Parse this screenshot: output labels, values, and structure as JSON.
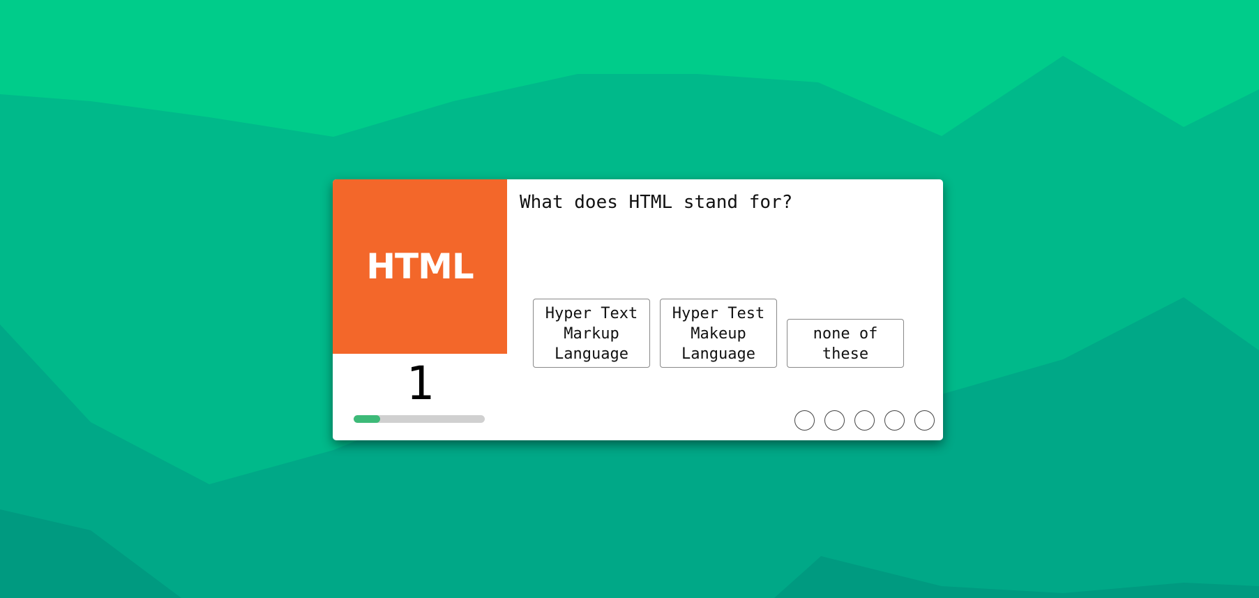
{
  "logo": {
    "text": "HTML"
  },
  "question": {
    "number": "1",
    "text": "What does HTML stand for?",
    "progress_fraction": 0.2
  },
  "answers": [
    {
      "label": "Hyper Text Markup Language"
    },
    {
      "label": "Hyper Test Makeup Language"
    },
    {
      "label": "none of these"
    }
  ],
  "status_dots": {
    "count": 5
  },
  "colors": {
    "background": "#00cc8a",
    "logo": "#f3672a",
    "progress": "#3dba78",
    "progress_track": "#d0d0d0"
  }
}
